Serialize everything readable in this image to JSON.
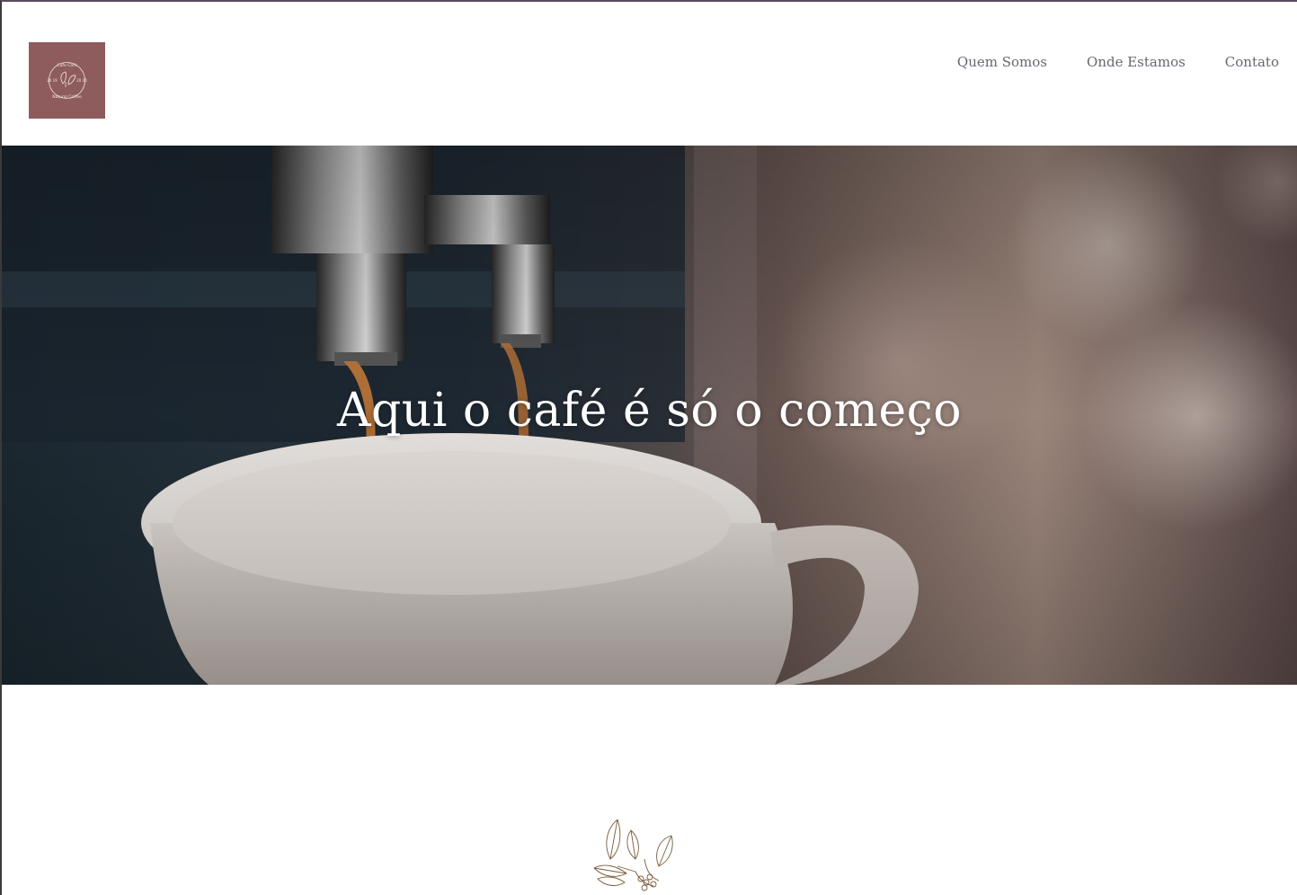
{
  "header": {
    "logo": {
      "text_top": "Cafe Café",
      "text_bottom": "Natural Coffee",
      "year_left": "20 19",
      "year_right": "20 20",
      "icon": "coffee-leaves-logo",
      "bg_color": "#8e5c5c"
    },
    "nav": [
      {
        "label": "Quem Somos"
      },
      {
        "label": "Onde Estamos"
      },
      {
        "label": "Contato"
      }
    ]
  },
  "hero": {
    "title": "Aqui o café é só o começo",
    "image": "espresso-machine-pouring-into-white-cup"
  },
  "section": {
    "icon": "coffee-branch-illustration"
  },
  "colors": {
    "accent": "#8e5c5c",
    "nav_text": "#6b6472",
    "hero_text": "#ffffff"
  }
}
